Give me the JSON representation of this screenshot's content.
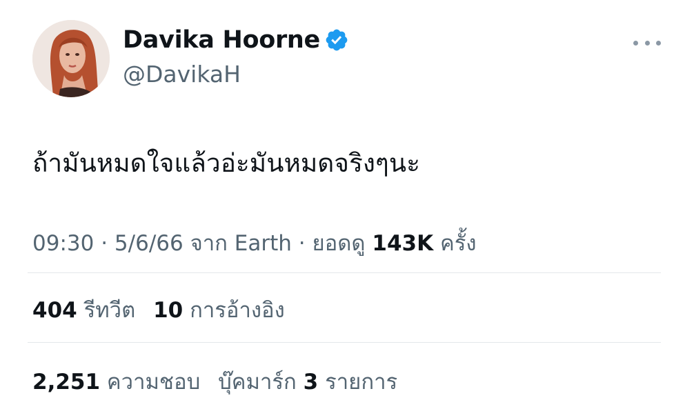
{
  "author": {
    "display_name": "Davika Hoorne",
    "handle": "@DavikaH",
    "verified": true,
    "verified_icon": "verified-badge-icon",
    "verified_color": "#1d9bf0"
  },
  "more_icon": "more-horizontal-icon",
  "tweet": {
    "text": "ถ้ามันหมดใจแล้วอ่ะมันหมดจริงๆนะ"
  },
  "meta": {
    "time": "09:30",
    "separator": "·",
    "date": "5/6/66",
    "source_prefix": "จาก",
    "source": "Earth",
    "views_label": "ยอดดู",
    "views_count": "143K",
    "views_suffix": "ครั้ง"
  },
  "engagement": {
    "retweets_count": "404",
    "retweets_label": "รีทวีต",
    "quotes_count": "10",
    "quotes_label": "การอ้างอิง",
    "likes_count": "2,251",
    "likes_label": "ความชอบ",
    "bookmarks_label": "บุ๊คมาร์ก",
    "bookmarks_count": "3",
    "bookmarks_suffix": "รายการ"
  }
}
